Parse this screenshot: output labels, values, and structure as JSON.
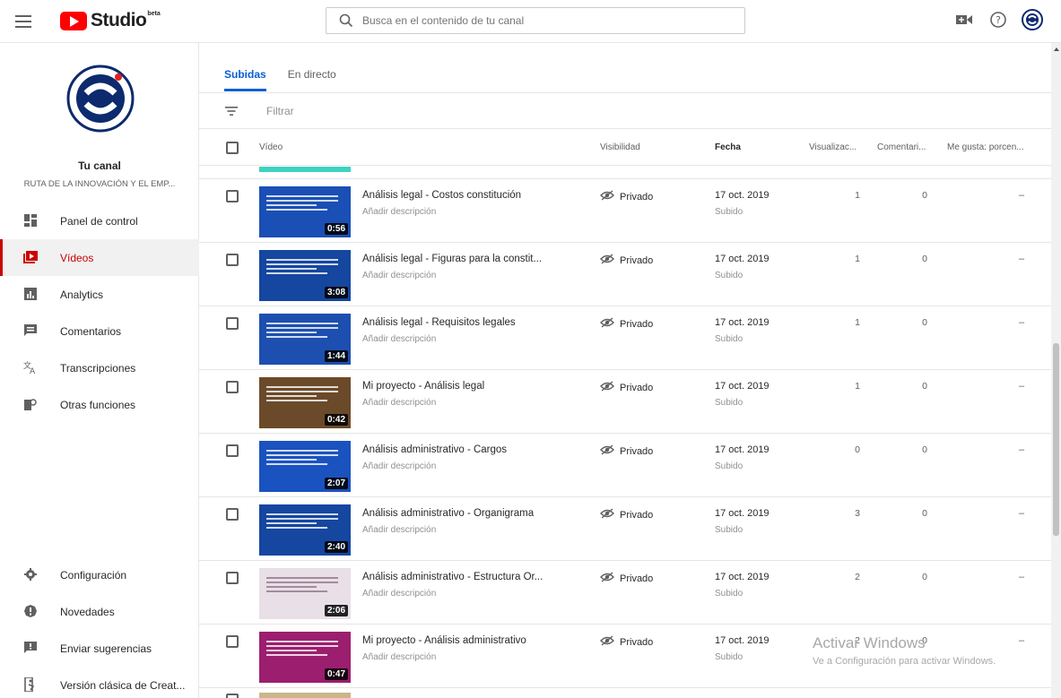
{
  "app": {
    "logo_text": "Studio",
    "logo_beta": "beta"
  },
  "search": {
    "placeholder": "Busca en el contenido de tu canal"
  },
  "sidebar": {
    "channel_title": "Tu canal",
    "channel_name": "RUTA DE LA INNOVACIÓN Y EL EMP...",
    "items": [
      {
        "label": "Panel de control",
        "icon": "dashboard-icon"
      },
      {
        "label": "Vídeos",
        "icon": "videos-icon",
        "active": true
      },
      {
        "label": "Analytics",
        "icon": "analytics-icon"
      },
      {
        "label": "Comentarios",
        "icon": "comments-icon"
      },
      {
        "label": "Transcripciones",
        "icon": "translate-icon"
      },
      {
        "label": "Otras funciones",
        "icon": "other-features-icon"
      }
    ],
    "bottom_items": [
      {
        "label": "Configuración",
        "icon": "gear-icon"
      },
      {
        "label": "Novedades",
        "icon": "alert-icon"
      },
      {
        "label": "Enviar sugerencias",
        "icon": "feedback-icon"
      },
      {
        "label": "Versión clásica de Creat...",
        "icon": "classic-icon"
      }
    ]
  },
  "tabs": [
    {
      "label": "Subidas",
      "active": true
    },
    {
      "label": "En directo"
    }
  ],
  "filter": {
    "placeholder": "Filtrar"
  },
  "table": {
    "headers": {
      "video": "Vídeo",
      "visibility": "Visibilidad",
      "date": "Fecha",
      "views": "Visualizac...",
      "comments": "Comentari...",
      "likes": "Me gusta: porcen..."
    },
    "rows": [
      {
        "title": "Análisis legal - Costos constitución",
        "description": "Añadir descripción",
        "visibility": "Privado",
        "date": "17 oct. 2019",
        "status": "Subido",
        "views": "1",
        "comments": "0",
        "likes": "–",
        "duration": "0:56",
        "thumb_color": "#1a4fb5"
      },
      {
        "title": "Análisis legal - Figuras para la constit...",
        "description": "Añadir descripción",
        "visibility": "Privado",
        "date": "17 oct. 2019",
        "status": "Subido",
        "views": "1",
        "comments": "0",
        "likes": "–",
        "duration": "3:08",
        "thumb_color": "#1546a0"
      },
      {
        "title": "Análisis legal - Requisitos legales",
        "description": "Añadir descripción",
        "visibility": "Privado",
        "date": "17 oct. 2019",
        "status": "Subido",
        "views": "1",
        "comments": "0",
        "likes": "–",
        "duration": "1:44",
        "thumb_color": "#1d4fb0"
      },
      {
        "title": "Mi proyecto - Análisis legal",
        "description": "Añadir descripción",
        "visibility": "Privado",
        "date": "17 oct. 2019",
        "status": "Subido",
        "views": "1",
        "comments": "0",
        "likes": "–",
        "duration": "0:42",
        "thumb_color": "#6b4a2a"
      },
      {
        "title": "Análisis administrativo - Cargos",
        "description": "Añadir descripción",
        "visibility": "Privado",
        "date": "17 oct. 2019",
        "status": "Subido",
        "views": "0",
        "comments": "0",
        "likes": "–",
        "duration": "2:07",
        "thumb_color": "#1a52c0"
      },
      {
        "title": "Análisis administrativo - Organigrama",
        "description": "Añadir descripción",
        "visibility": "Privado",
        "date": "17 oct. 2019",
        "status": "Subido",
        "views": "3",
        "comments": "0",
        "likes": "–",
        "duration": "2:40",
        "thumb_color": "#1546a0"
      },
      {
        "title": "Análisis administrativo - Estructura Or...",
        "description": "Añadir descripción",
        "visibility": "Privado",
        "date": "17 oct. 2019",
        "status": "Subido",
        "views": "2",
        "comments": "0",
        "likes": "–",
        "duration": "2:06",
        "thumb_color": "#e8e0e6"
      },
      {
        "title": "Mi proyecto - Análisis administrativo",
        "description": "Añadir descripción",
        "visibility": "Privado",
        "date": "17 oct. 2019",
        "status": "Subido",
        "views": "2",
        "comments": "0",
        "likes": "–",
        "duration": "0:47",
        "thumb_color": "#9c1e6e"
      }
    ]
  },
  "watermark": {
    "line1": "Activar Windows",
    "line2": "Ve a Configuración para activar Windows."
  },
  "colors": {
    "accent": "#065fd4",
    "active_nav": "#cc0000",
    "brand": "#ff0000"
  }
}
